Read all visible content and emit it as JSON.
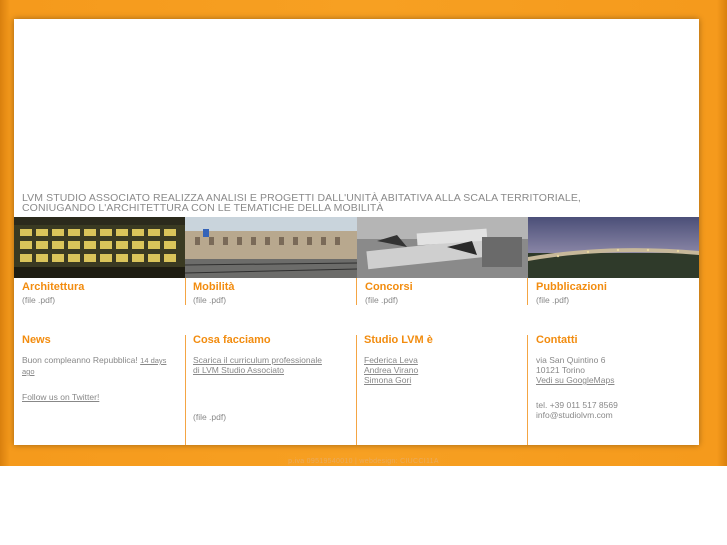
{
  "tagline": {
    "line1": "LVM STUDIO ASSOCIATO REALIZZA ANALISI E PROGETTI DALL'UNITÀ ABITATIVA ALLA SCALA TERRITORIALE,",
    "line2": "CONIUGANDO L'ARCHITETTURA CON LE TEMATICHE DELLA MOBILITÀ"
  },
  "categories": [
    {
      "title": "Architettura",
      "sub": "(file .pdf)"
    },
    {
      "title": "Mobilità",
      "sub": "(file .pdf)"
    },
    {
      "title": "Concorsi",
      "sub": "(file .pdf)"
    },
    {
      "title": "Pubblicazioni",
      "sub": "(file .pdf)"
    }
  ],
  "news": {
    "title": "News",
    "item_text": "Buon compleanno Repubblica!",
    "item_time": "14 days ago",
    "twitter_link": "Follow us on Twitter!"
  },
  "cosa_facciamo": {
    "title": "Cosa facciamo",
    "cv_link_line1": "Scarica il curriculum professionale",
    "cv_link_line2": "di LVM Studio Associato",
    "file_note": "(file .pdf)"
  },
  "studio": {
    "title": "Studio LVM è",
    "members": [
      "Federica Leva",
      "Andrea Virano",
      "Simona Gori"
    ]
  },
  "contatti": {
    "title": "Contatti",
    "address1": "via San Quintino 6",
    "address2": "10121 Torino",
    "maps_link": "Vedi su GoogleMaps",
    "phone": "tel. +39 011 517 8569",
    "email": "info@studiolvm.com"
  },
  "footer": "p.iva 09519540010 | webdesign: CIUCCI11A",
  "colors": {
    "accent": "#f28c0f",
    "frame": "#f7a022",
    "text": "#888888"
  }
}
